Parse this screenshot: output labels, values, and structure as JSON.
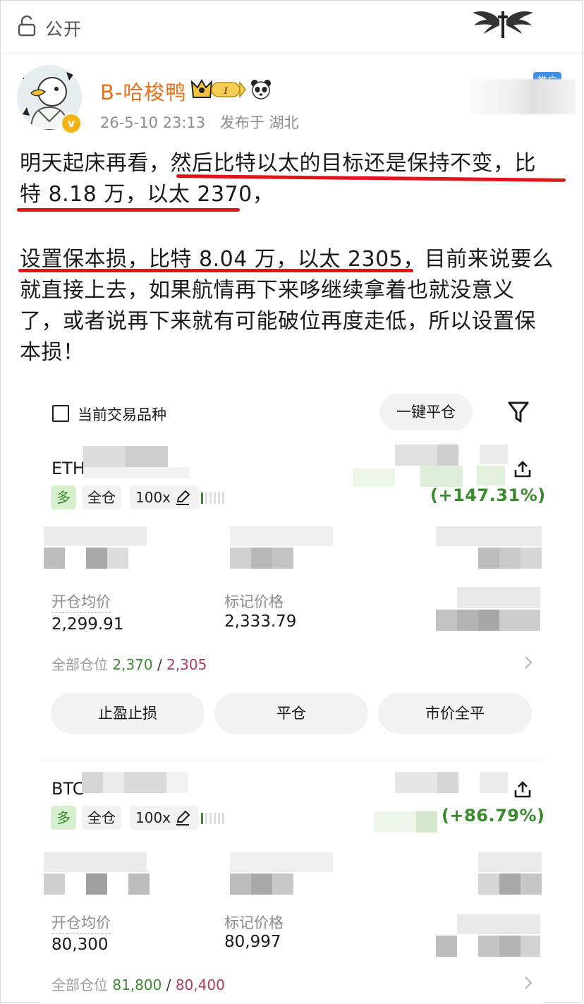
{
  "topbar": {
    "visibility_label": "公开"
  },
  "post": {
    "username": "B-哈梭鸭",
    "vip_level": "I",
    "timestamp": "26-5-10 23:13",
    "location": "发布于 湖北",
    "promo_tag": "推广",
    "paragraph1": {
      "line1_a": "明天起床再看，",
      "line1_b": "然后比特以太的目标还是保持不变，比",
      "line2_a": "特 8.18 万，以太 2370",
      "line2_b": "，"
    },
    "paragraph2": {
      "line1_a": "设置保本损，比特 8.04 万，以太 2305",
      "line1_b": "，目前来说要么",
      "line2": "就直接上去，如果航情再下来哆继续拿着也就没意义",
      "line3": "了，或者说再下来就有可能破位再度走低，所以设置保",
      "line4": "本损！"
    }
  },
  "trade_panel": {
    "current_symbol_label": "当前交易品种",
    "close_all_label": "一键平仓",
    "positions": [
      {
        "symbol": "ETH",
        "pnl_pct": "(+147.31%)",
        "side": "多",
        "margin_mode": "全仓",
        "leverage": "100x",
        "entry_label": "开仓均价",
        "entry_value": "2,299.91",
        "mark_label": "标记价格",
        "mark_value": "2,333.79",
        "all_pos_label": "全部仓位",
        "tp": "2,370",
        "sep": "/",
        "sl": "2,305"
      },
      {
        "symbol": "BTC",
        "pnl_pct": "(+86.79%)",
        "side": "多",
        "margin_mode": "全仓",
        "leverage": "100x",
        "entry_label": "开仓均价",
        "entry_value": "80,300",
        "mark_label": "标记价格",
        "mark_value": "80,997",
        "all_pos_label": "全部仓位",
        "tp": "81,800",
        "sep": "/",
        "sl": "80,400"
      }
    ],
    "actions": {
      "tp_sl": "止盈止损",
      "close": "平仓",
      "market_close_all": "市价全平"
    }
  }
}
